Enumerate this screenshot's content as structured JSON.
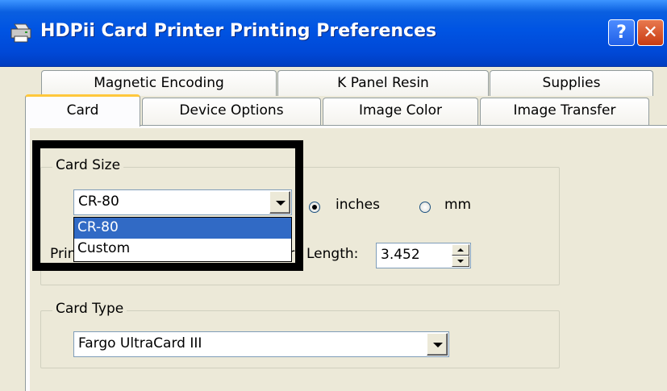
{
  "window": {
    "title": "HDPii Card Printer Printing Preferences",
    "help_label": "?",
    "close_label": "✕"
  },
  "tabs": {
    "row1": [
      "Magnetic Encoding",
      "K Panel Resin",
      "Supplies"
    ],
    "row2": [
      "Card",
      "Device Options",
      "Image Color",
      "Image Transfer"
    ],
    "active": "Card"
  },
  "card_size": {
    "legend": "Card Size",
    "selected": "CR-80",
    "options": [
      "CR-80",
      "Custom"
    ],
    "highlighted_option": "CR-80",
    "units": {
      "inches_label": "inches",
      "mm_label": "mm",
      "selected": "inches"
    },
    "print_width_label_partial": "Print W",
    "length_label_partial": "Card",
    "length_label": "Length:",
    "length_value": "3.452"
  },
  "card_type": {
    "legend": "Card Type",
    "selected": "Fargo UltraCard III"
  },
  "colors": {
    "titlebar": "#0054e3",
    "selection": "#316ac5",
    "active_tab_accent": "#ffc83c",
    "highlight_box": "#000000"
  }
}
